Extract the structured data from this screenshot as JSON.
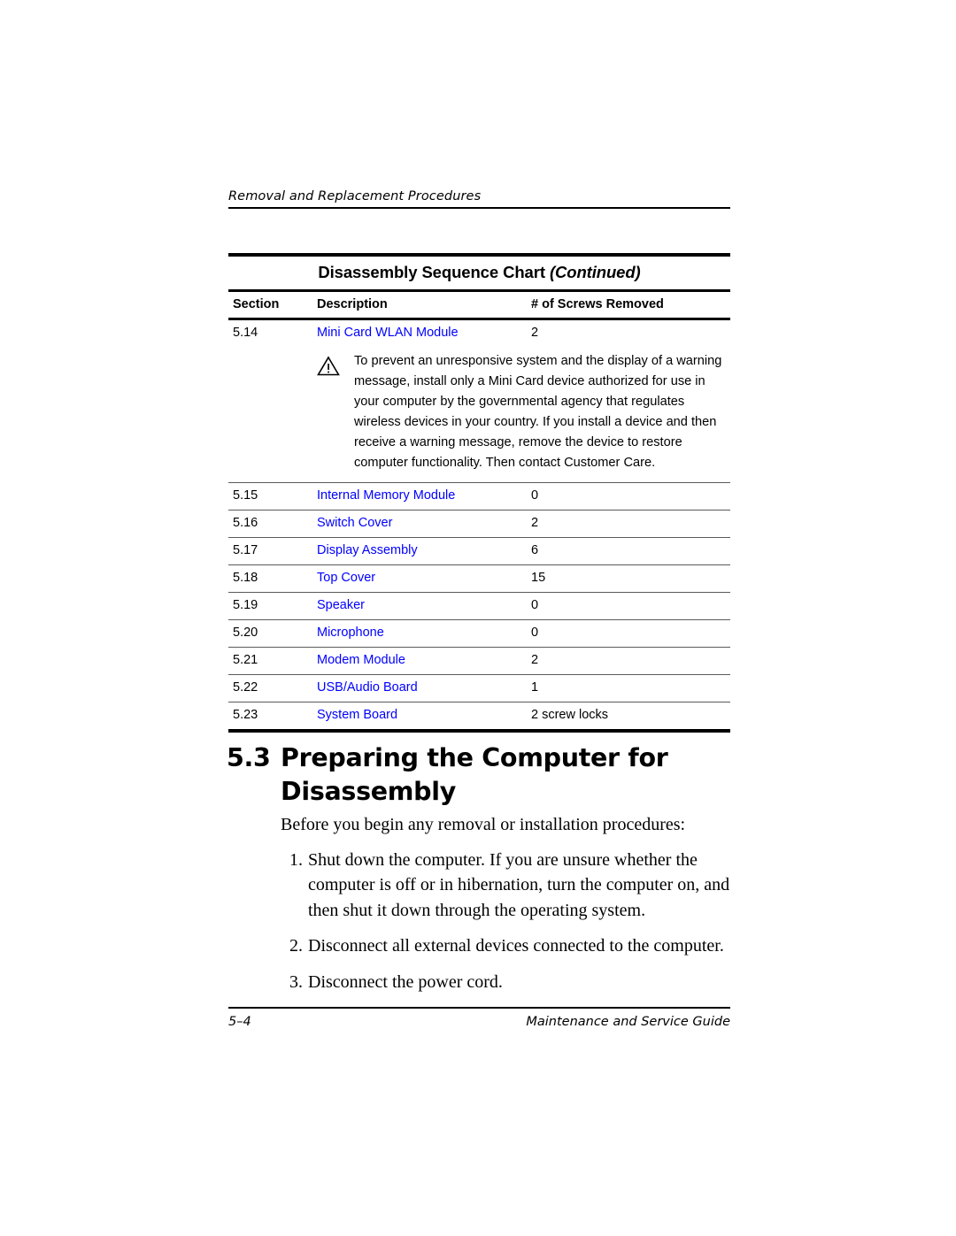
{
  "running_head": "Removal and Replacement Procedures",
  "table": {
    "title_main": "Disassembly Sequence Chart ",
    "title_continued": "(Continued)",
    "columns": {
      "section": "Section",
      "description": "Description",
      "screws": "# of Screws Removed"
    },
    "rows": [
      {
        "section": "5.14",
        "description": "Mini Card WLAN Module",
        "screws": "2"
      },
      {
        "section": "5.15",
        "description": "Internal Memory Module",
        "screws": "0"
      },
      {
        "section": "5.16",
        "description": "Switch Cover",
        "screws": "2"
      },
      {
        "section": "5.17",
        "description": "Display Assembly",
        "screws": "6"
      },
      {
        "section": "5.18",
        "description": "Top Cover",
        "screws": "15"
      },
      {
        "section": "5.19",
        "description": "Speaker",
        "screws": "0"
      },
      {
        "section": "5.20",
        "description": "Microphone",
        "screws": "0"
      },
      {
        "section": "5.21",
        "description": "Modem Module",
        "screws": "2"
      },
      {
        "section": "5.22",
        "description": "USB/Audio Board",
        "screws": "1"
      },
      {
        "section": "5.23",
        "description": "System Board",
        "screws": "2 screw locks"
      }
    ],
    "caution": {
      "icon": "warning-triangle-icon",
      "text": "To prevent an unresponsive system and the display of a warning message, install only a Mini Card device authorized for use in your computer by the governmental agency that regulates wireless devices in your country. If you install a device and then receive a warning message, remove the device to restore computer functionality. Then contact Customer Care."
    }
  },
  "section": {
    "number": "5.3",
    "title": "Preparing the Computer for Disassembly",
    "intro": "Before you begin any removal or installation procedures:",
    "steps": [
      {
        "num": "1.",
        "text": "Shut down the computer. If you are unsure whether the computer is off or in hibernation, turn the computer on, and then shut it down through the operating system."
      },
      {
        "num": "2.",
        "text": "Disconnect all external devices connected to the computer."
      },
      {
        "num": "3.",
        "text": "Disconnect the power cord."
      }
    ]
  },
  "footer": {
    "page_number": "5–4",
    "guide_title": "Maintenance and Service Guide"
  },
  "colors": {
    "link": "#0000FF",
    "text": "#000000"
  }
}
